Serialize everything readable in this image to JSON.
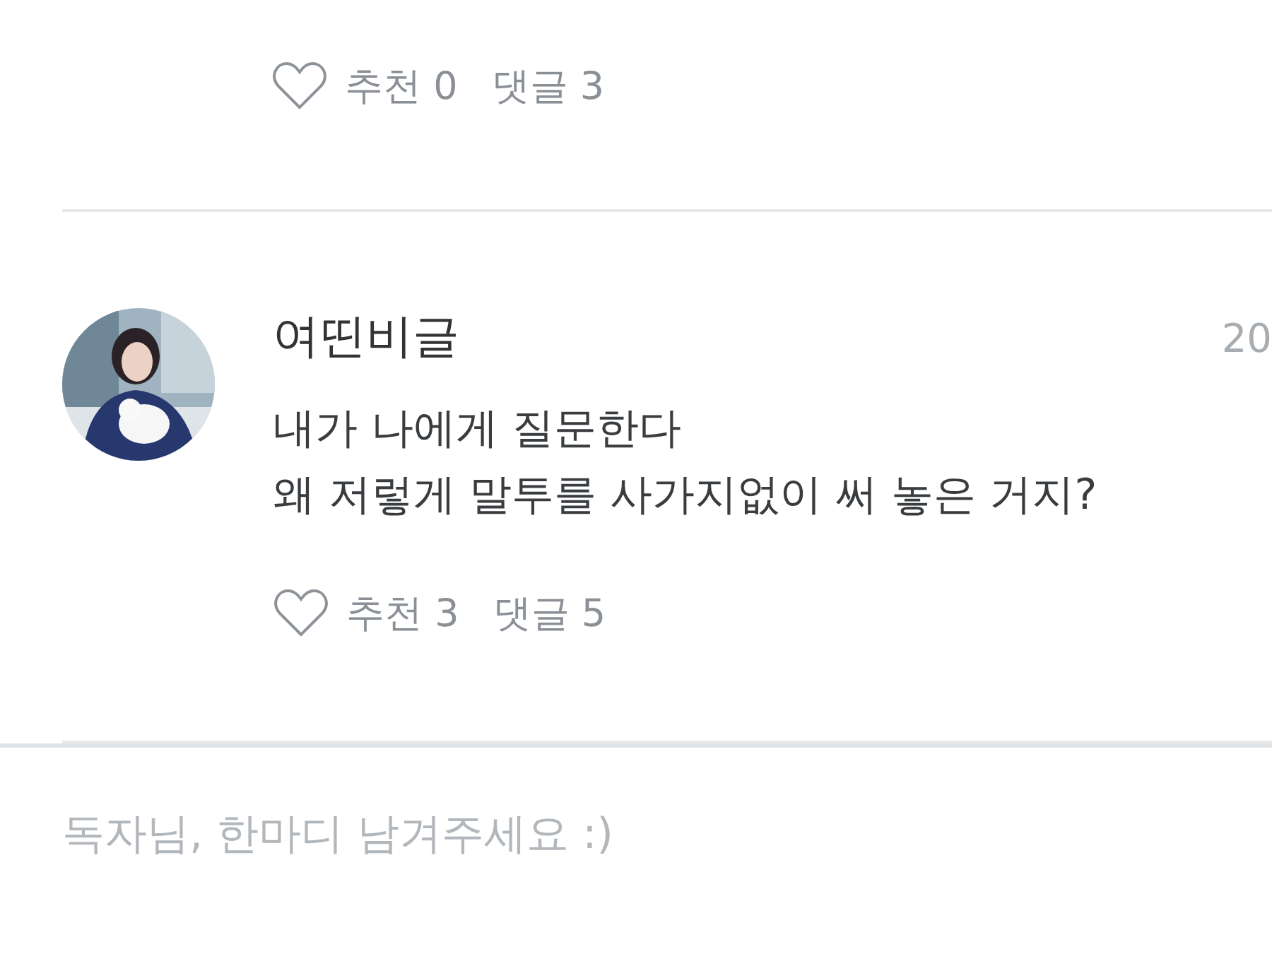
{
  "comments": [
    {
      "likes": "추천 0",
      "replies": "댓글 3"
    },
    {
      "author": "여띤비글",
      "date": "20",
      "text": "내가 나에게 질문한다\n왜 저렇게 말투를 사가지없이 써 놓은 거지?",
      "likes": "추천 3",
      "replies": "댓글 5"
    }
  ],
  "composer": {
    "placeholder": "독자님, 한마디 남겨주세요 :)"
  }
}
